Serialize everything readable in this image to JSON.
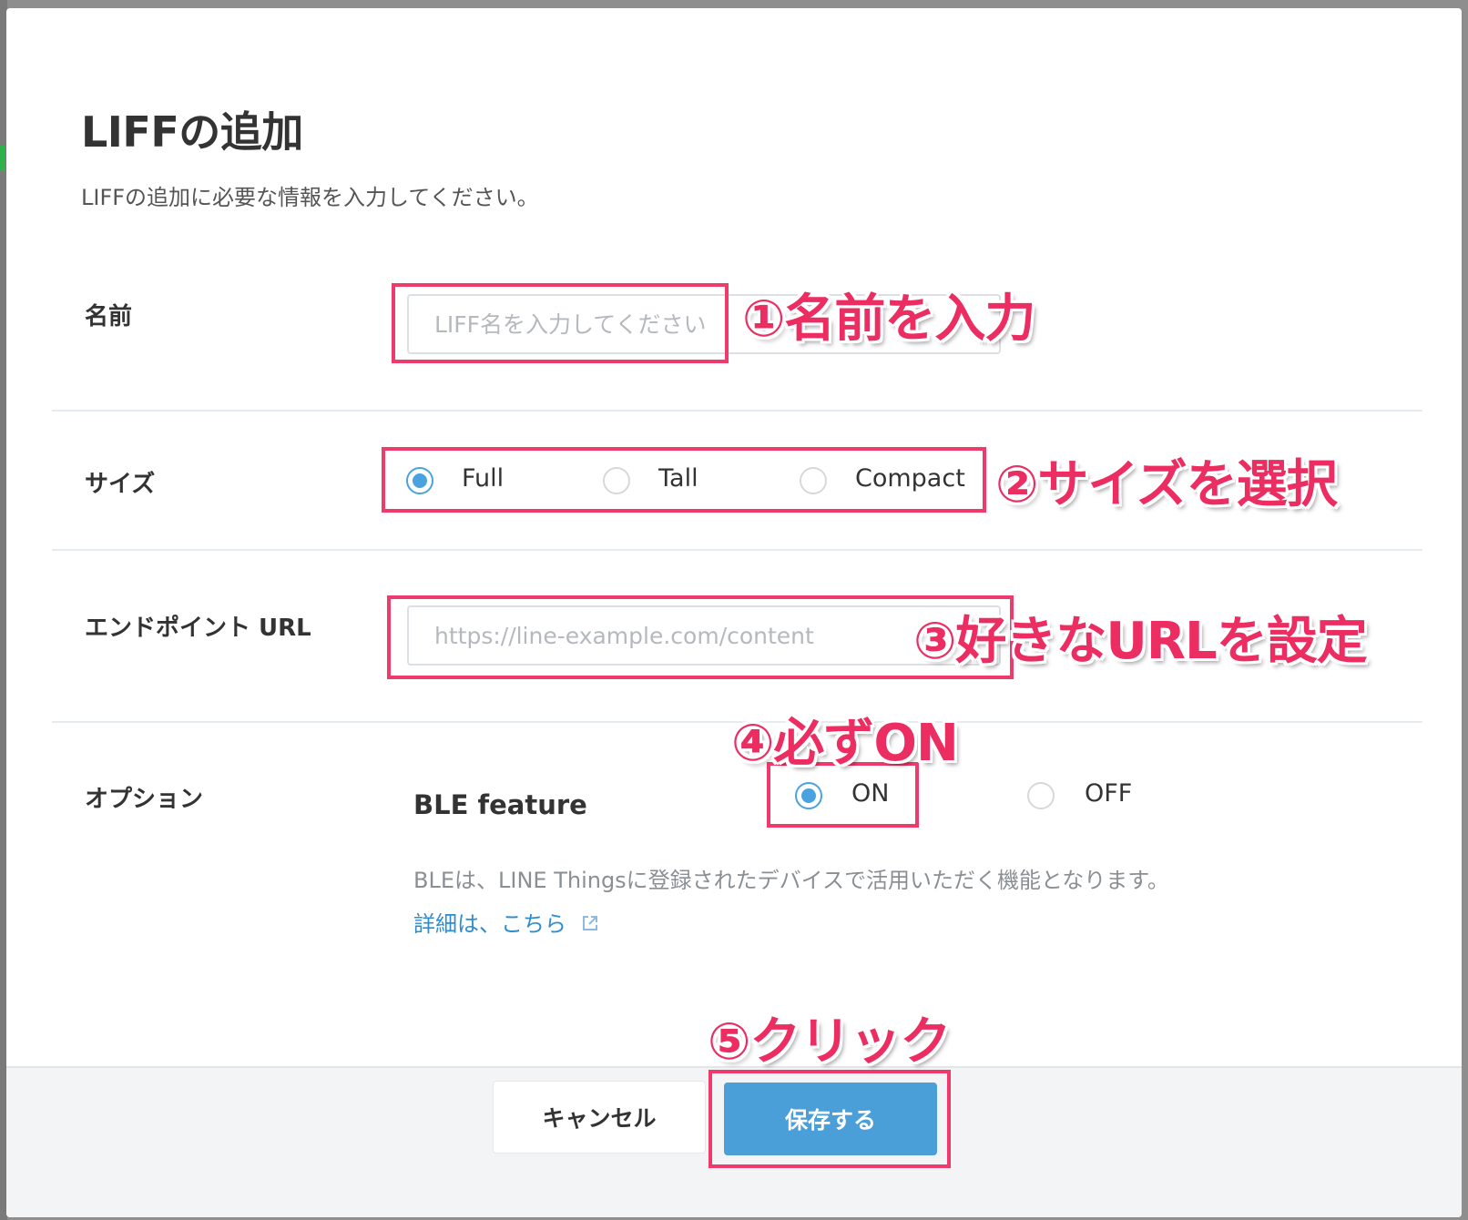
{
  "dialog": {
    "title": "LIFFの追加",
    "subtitle": "LIFFの追加に必要な情報を入力してください。"
  },
  "name_row": {
    "label": "名前",
    "placeholder": "LIFF名を入力してください",
    "value": ""
  },
  "size_row": {
    "label": "サイズ",
    "options": [
      "Full",
      "Tall",
      "Compact"
    ],
    "selected": "Full"
  },
  "endpoint_row": {
    "label": "エンドポイント URL",
    "placeholder": "https://line-example.com/content",
    "value": ""
  },
  "options_row": {
    "label": "オプション",
    "feature_title": "BLE feature",
    "choices": [
      "ON",
      "OFF"
    ],
    "selected": "ON",
    "help_text": "BLEは、LINE Thingsに登録されたデバイスで活用いただく機能となります。",
    "help_link": "詳細は、こちら"
  },
  "footer": {
    "cancel_label": "キャンセル",
    "save_label": "保存する"
  },
  "annotations": {
    "step1": "①名前を入力",
    "step2": "②サイズを選択",
    "step3": "③好きなURLを設定",
    "step4": "④必ずON",
    "step5": "⑤クリック"
  },
  "colors": {
    "accent": "#4a9fd8",
    "annotation": "#ec2d62",
    "link": "#2f8ccf"
  }
}
